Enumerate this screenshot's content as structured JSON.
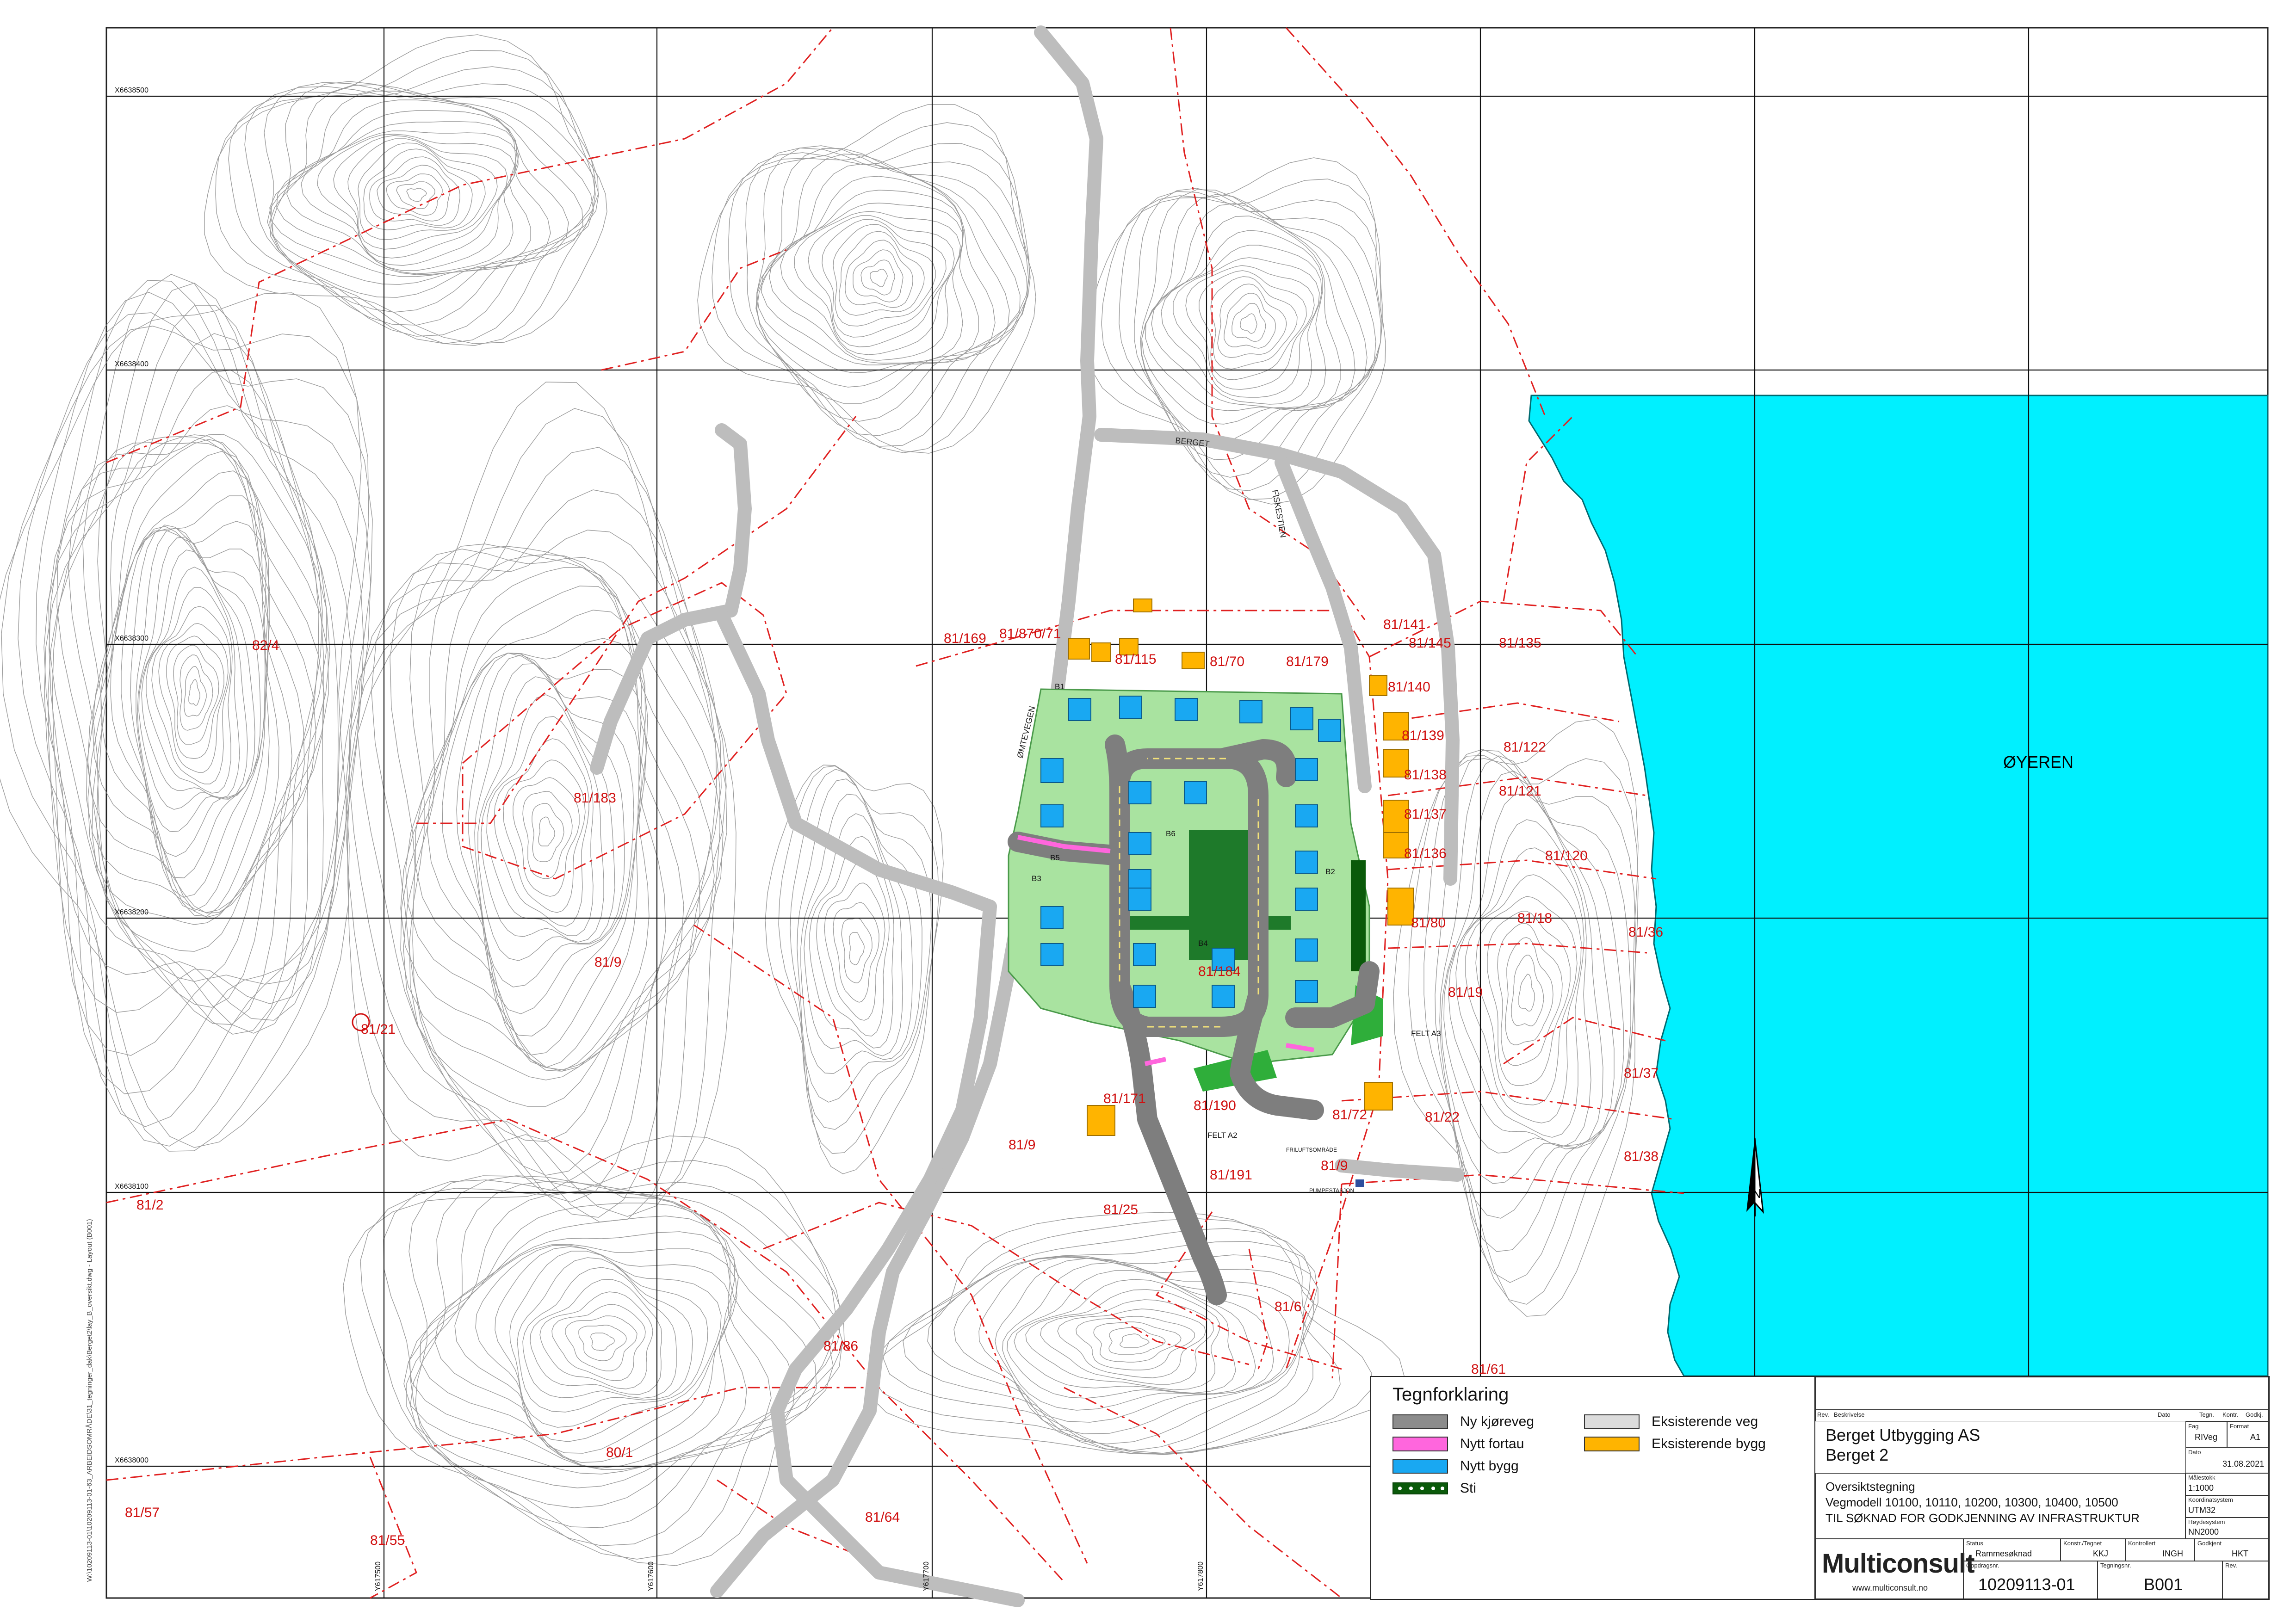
{
  "lake": {
    "label": "ØYEREN",
    "color": "#00f0ff"
  },
  "grid_labels": {
    "x": [
      "X6638500",
      "X6638400",
      "X6638300",
      "X6638200",
      "X6638100",
      "X6638000"
    ],
    "y": [
      "Y617500",
      "Y617600",
      "Y617700",
      "Y617800"
    ]
  },
  "road_labels": [
    "BERGET",
    "FISKESTIEN",
    "ØMTEVEGEN"
  ],
  "parcels": [
    "82/4",
    "81/183",
    "81/9",
    "81/21",
    "81/2",
    "81/57",
    "81/55",
    "80/1",
    "81/64",
    "81/86",
    "81/25",
    "81/9",
    "81/191",
    "81/190",
    "81/6",
    "81/61",
    "81/169",
    "81/870/71",
    "81/115",
    "81/70",
    "81/179",
    "81/141",
    "81/145",
    "81/135",
    "81/140",
    "81/139",
    "81/138",
    "81/122",
    "81/121",
    "81/137",
    "81/136",
    "81/120",
    "81/80",
    "81/18",
    "81/36",
    "81/19",
    "81/37",
    "81/38",
    "81/72",
    "81/22",
    "81/9",
    "81/184",
    "81/171"
  ],
  "field_labels": [
    "B1",
    "B2",
    "B3",
    "B4",
    "B5",
    "B6",
    "FELT A3",
    "FELT A2",
    "FRILUFTSOMRÅDE",
    "PUMPESTASJON"
  ],
  "legend": {
    "title": "Tegnforklaring",
    "items": [
      {
        "label": "Ny kjøreveg",
        "color": "#8c8c8c"
      },
      {
        "label": "Nytt fortau",
        "color": "#ff66dd"
      },
      {
        "label": "Nytt bygg",
        "color": "#19a8f2"
      },
      {
        "label": "Sti",
        "color": "#0a5a0a"
      },
      {
        "label": "Eksisterende veg",
        "color": "#dcdcdc"
      },
      {
        "label": "Eksisterende bygg",
        "color": "#ffb400"
      }
    ]
  },
  "title_block": {
    "header": {
      "rev": "Rev.",
      "beskrivelse": "Beskrivelse",
      "dato": "Dato",
      "tegn": "Tegn.",
      "kontr": "Kontr.",
      "godkj": "Godkj."
    },
    "client": "Berget Utbygging AS",
    "project": "Berget 2",
    "fag_label": "Fag",
    "fag": "RIVeg",
    "format_label": "Format",
    "format": "A1",
    "dato_label": "Dato",
    "dato": "31.08.2021",
    "malestokk_label": "Målestokk",
    "malestokk": "1:1000",
    "koord_label": "Koordinatsystem",
    "koord": "UTM32",
    "hoyde_label": "Høydesystem",
    "hoyde": "NN2000",
    "drawing_title": "Oversiktstegning",
    "drawing_sub1": "Vegmodell 10100, 10110, 10200, 10300, 10400, 10500",
    "drawing_sub2": "TIL SØKNAD FOR GODKJENNING AV INFRASTRUKTUR",
    "status_label": "Status",
    "status": "Rammesøknad",
    "konstr_label": "Konstr./Tegnet",
    "konstr": "KKJ",
    "kontrollert_label": "Kontrollert",
    "kontrollert": "INGH",
    "godkjent_label": "Godkjent",
    "godkjent": "HKT",
    "company": "Multiconsult",
    "website": "www.multiconsult.no",
    "oppdragsnr_label": "Oppdragsnr.",
    "oppdragsnr": "10209113-01",
    "tegningsnr_label": "Tegningsnr.",
    "tegningsnr": "B001",
    "rev_label": "Rev."
  },
  "side_path": "W:\\10209113-01\\10209113-01-63_ARBEIDSOMRÅDE\\31_tegninger_dak\\Berget2\\lay_B_oversikt.dwg - Layout (B001)",
  "north_arrow": "N"
}
